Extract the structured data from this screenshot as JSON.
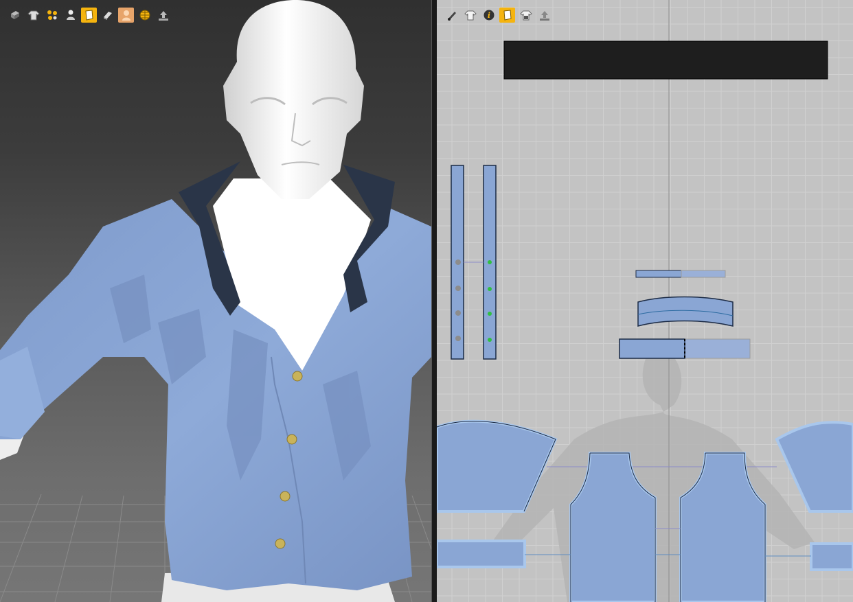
{
  "app": {
    "accent_color": "#f5b40f",
    "fabric_color": "#8aa6d4",
    "fabric_outline_color": "#a9c7ec",
    "collar_color": "#2a3548",
    "button_color": "#c9b35a",
    "avatar_color": "#f2f2f2",
    "grid_bg_color": "#c3c3c3"
  },
  "viewport3d": {
    "toolbar": [
      {
        "icon": "texture-surface-icon",
        "active": false
      },
      {
        "icon": "garment-display-icon",
        "active": false
      },
      {
        "icon": "particle-points-icon",
        "active": false
      },
      {
        "icon": "avatar-display-icon",
        "active": false
      },
      {
        "icon": "fabric-display-icon",
        "active": true
      },
      {
        "icon": "show-flat-icon",
        "active": false
      },
      {
        "icon": "avatar-skin-icon",
        "active": false
      },
      {
        "icon": "mesh-globe-icon",
        "active": false
      },
      {
        "icon": "export-upload-icon",
        "active": false
      }
    ],
    "buttons_on_shirt": 4
  },
  "viewport2d": {
    "toolbar": [
      {
        "icon": "pen-tool-icon",
        "active": false
      },
      {
        "icon": "garment-display-icon",
        "active": false
      },
      {
        "icon": "info-icon",
        "active": false
      },
      {
        "icon": "fabric-display-icon",
        "active": true
      },
      {
        "icon": "lock-garment-icon",
        "active": false
      },
      {
        "icon": "export-upload-icon",
        "active": false
      }
    ]
  }
}
